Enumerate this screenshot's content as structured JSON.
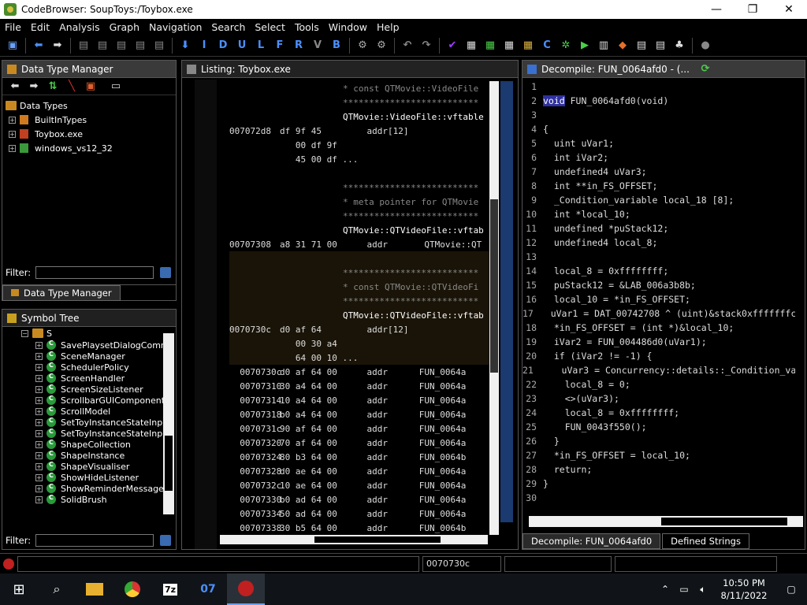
{
  "window": {
    "title": "CodeBrowser: SoupToys:/Toybox.exe"
  },
  "menu": [
    "File",
    "Edit",
    "Analysis",
    "Graph",
    "Navigation",
    "Search",
    "Select",
    "Tools",
    "Window",
    "Help"
  ],
  "toolbar": {
    "letters": [
      "I",
      "D",
      "U",
      "L",
      "F",
      "R",
      "V",
      "B"
    ]
  },
  "dtm": {
    "title": "Data Type Manager",
    "root": "Data Types",
    "items": [
      "BuiltInTypes",
      "Toybox.exe",
      "windows_vs12_32"
    ],
    "filter_label": "Filter:",
    "tab_label": "Data Type Manager"
  },
  "symtree": {
    "title": "Symbol Tree",
    "folder": "S",
    "items": [
      "SavePlaysetDialogComm",
      "SceneManager",
      "SchedulerPolicy",
      "ScreenHandler",
      "ScreenSizeListener",
      "ScrollbarGUIComponent",
      "ScrollModel",
      "SetToyInstanceStateInp",
      "SetToyInstanceStateInp",
      "ShapeCollection",
      "ShapeInstance",
      "ShapeVisualiser",
      "ShowHideListener",
      "ShowReminderMessage",
      "SolidBrush"
    ],
    "filter_label": "Filter:"
  },
  "listing": {
    "title": "Listing:  Toybox.exe",
    "lines": [
      {
        "a": "",
        "b": "",
        "t": "* const QTMovie::VideoFile",
        "c": "cmt"
      },
      {
        "a": "",
        "b": "",
        "t": "**************************",
        "c": "cmt"
      },
      {
        "a": "",
        "b": "",
        "t": "QTMovie::VideoFile::vftable",
        "c": "lbl"
      },
      {
        "a": "007072d8",
        "b": "df 9f 45",
        "t": "    addr[12]",
        "c": "op"
      },
      {
        "a": "",
        "b": "   00 df 9f",
        "t": "",
        "c": "op"
      },
      {
        "a": "",
        "b": "   45 00 df ...",
        "t": "",
        "c": "op"
      },
      {
        "a": "",
        "b": "",
        "t": "",
        "c": "op"
      },
      {
        "a": "",
        "b": "",
        "t": "**************************",
        "c": "cmt"
      },
      {
        "a": "",
        "b": "",
        "t": "* meta pointer for QTMovie",
        "c": "cmt"
      },
      {
        "a": "",
        "b": "",
        "t": "**************************",
        "c": "cmt"
      },
      {
        "a": "",
        "b": "",
        "t": "QTMovie::QTVideoFile::vftab",
        "c": "lbl"
      },
      {
        "a": "00707308",
        "b": "a8 31 71 00",
        "t": "    addr       QTMovie::QT",
        "c": "op"
      },
      {
        "a": "",
        "b": "",
        "t": "",
        "c": "op"
      },
      {
        "a": "",
        "b": "",
        "t": "**************************",
        "c": "cmt"
      },
      {
        "a": "",
        "b": "",
        "t": "* const QTMovie::QTVideoFi",
        "c": "cmt"
      },
      {
        "a": "",
        "b": "",
        "t": "**************************",
        "c": "cmt"
      },
      {
        "a": "",
        "b": "",
        "t": "QTMovie::QTVideoFile::vftab",
        "c": "lbl"
      },
      {
        "a": "0070730c",
        "b": "d0 af 64",
        "t": "    addr[12]",
        "c": "op"
      },
      {
        "a": "",
        "b": "   00 30 a4",
        "t": "",
        "c": "op"
      },
      {
        "a": "",
        "b": "   64 00 10 ...",
        "t": "",
        "c": "op"
      },
      {
        "a": "  0070730c",
        "b": "d0 af 64 00",
        "t": "    addr      FUN_0064a",
        "c": "op"
      },
      {
        "a": "  00707310",
        "b": "30 a4 64 00",
        "t": "    addr      FUN_0064a",
        "c": "op"
      },
      {
        "a": "  00707314",
        "b": "10 a4 64 00",
        "t": "    addr      FUN_0064a",
        "c": "op"
      },
      {
        "a": "  00707318",
        "b": "b0 a4 64 00",
        "t": "    addr      FUN_0064a",
        "c": "op"
      },
      {
        "a": "  0070731c",
        "b": "90 af 64 00",
        "t": "    addr      FUN_0064a",
        "c": "op"
      },
      {
        "a": "  00707320",
        "b": "70 af 64 00",
        "t": "    addr      FUN_0064a",
        "c": "op"
      },
      {
        "a": "  00707324",
        "b": "80 b3 64 00",
        "t": "    addr      FUN_0064b",
        "c": "op"
      },
      {
        "a": "  00707328",
        "b": "d0 ae 64 00",
        "t": "    addr      FUN_0064a",
        "c": "op"
      },
      {
        "a": "  0070732c",
        "b": "10 ae 64 00",
        "t": "    addr      FUN_0064a",
        "c": "op"
      },
      {
        "a": "  00707330",
        "b": "b0 ad 64 00",
        "t": "    addr      FUN_0064a",
        "c": "op"
      },
      {
        "a": "  00707334",
        "b": "50 ad 64 00",
        "t": "    addr      FUN_0064a",
        "c": "op"
      },
      {
        "a": "  00707338",
        "b": "30 b5 64 00",
        "t": "    addr      FUN_0064b",
        "c": "op"
      }
    ]
  },
  "decompile": {
    "title": "Decompile: FUN_0064afd0 - (...",
    "lines": [
      "",
      "void FUN_0064afd0(void)",
      "",
      "{",
      "  uint uVar1;",
      "  int iVar2;",
      "  undefined4 uVar3;",
      "  int **in_FS_OFFSET;",
      "  _Condition_variable local_18 [8];",
      "  int *local_10;",
      "  undefined *puStack12;",
      "  undefined4 local_8;",
      "",
      "  local_8 = 0xffffffff;",
      "  puStack12 = &LAB_006a3b8b;",
      "  local_10 = *in_FS_OFFSET;",
      "  uVar1 = DAT_00742708 ^ (uint)&stack0xfffffffc;",
      "  *in_FS_OFFSET = (int *)&local_10;",
      "  iVar2 = FUN_004486d0(uVar1);",
      "  if (iVar2 != -1) {",
      "    uVar3 = Concurrency::details::_Condition_va",
      "    local_8 = 0;",
      "    <>(uVar3);",
      "    local_8 = 0xffffffff;",
      "    FUN_0043f550();",
      "  }",
      "  *in_FS_OFFSET = local_10;",
      "  return;",
      "}",
      ""
    ],
    "tabs": [
      "Decompile: FUN_0064afd0",
      "Defined Strings"
    ]
  },
  "status": {
    "address": "0070730c"
  },
  "taskbar": {
    "time": "10:50 PM",
    "date": "8/11/2022"
  },
  "colors": {
    "accent": "#3030a0",
    "global": "#e07070",
    "type": "#9aa0ff"
  }
}
